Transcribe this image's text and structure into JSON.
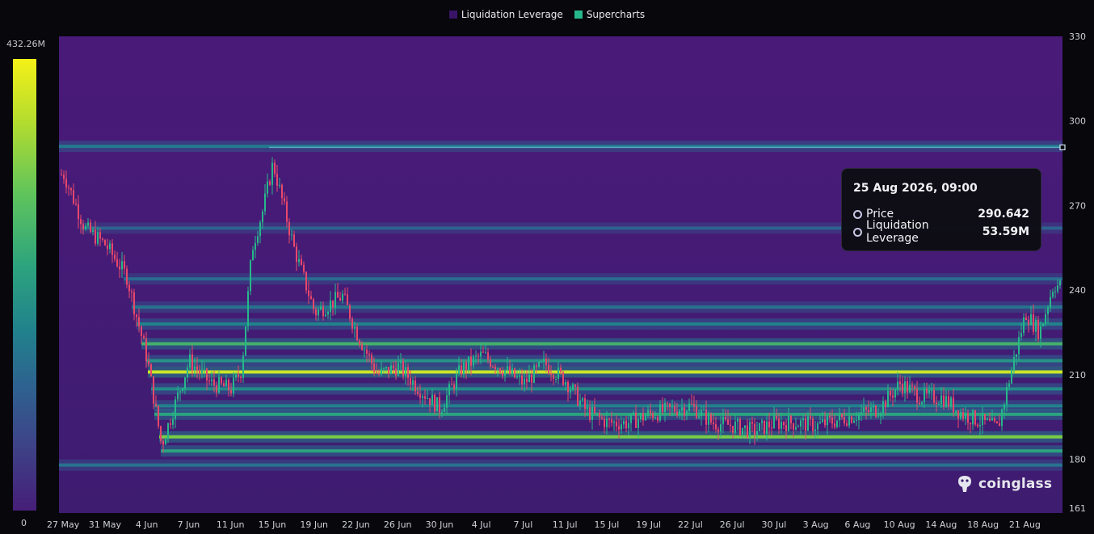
{
  "legend": [
    {
      "label": "Liquidation Leverage",
      "color": "#3a1466"
    },
    {
      "label": "Supercharts",
      "color": "#26b88a"
    }
  ],
  "color_scale": {
    "max_label": "432.26M",
    "min_label": "0"
  },
  "tooltip": {
    "title": "25 Aug 2026, 09:00",
    "rows": [
      {
        "label": "Price",
        "value": "290.642"
      },
      {
        "label": "Liquidation Leverage",
        "value": "53.59M"
      }
    ]
  },
  "brand": {
    "name": "coinglass"
  },
  "chart_data": {
    "type": "heatmap",
    "title": "",
    "xlabel": "",
    "ylabel": "",
    "x_tick_labels": [
      "27 May",
      "31 May",
      "4 Jun",
      "7 Jun",
      "11 Jun",
      "15 Jun",
      "19 Jun",
      "22 Jun",
      "26 Jun",
      "30 Jun",
      "4 Jul",
      "7 Jul",
      "11 Jul",
      "15 Jul",
      "19 Jul",
      "22 Jul",
      "26 Jul",
      "30 Jul",
      "3 Aug",
      "6 Aug",
      "10 Aug",
      "14 Aug",
      "18 Aug",
      "21 Aug"
    ],
    "y_ticks": [
      161,
      180,
      210,
      240,
      270,
      300,
      330
    ],
    "ylim": [
      161,
      330
    ],
    "legend_position": "top",
    "colors": {
      "up": "#26b88a",
      "down": "#e8486a",
      "heat_low": "#461e78",
      "heat_high": "#f5f117"
    },
    "current_price": 290.642,
    "price_path": [
      {
        "x": "27 May",
        "y": 281
      },
      {
        "x": "29 May",
        "y": 262
      },
      {
        "x": "31 May",
        "y": 256
      },
      {
        "x": "2 Jun",
        "y": 245
      },
      {
        "x": "4 Jun",
        "y": 215
      },
      {
        "x": "5 Jun",
        "y": 185
      },
      {
        "x": "7 Jun",
        "y": 215
      },
      {
        "x": "9 Jun",
        "y": 207
      },
      {
        "x": "11 Jun",
        "y": 205
      },
      {
        "x": "12 Jun",
        "y": 212
      },
      {
        "x": "13 Jun",
        "y": 255
      },
      {
        "x": "14 Jun",
        "y": 268
      },
      {
        "x": "15 Jun",
        "y": 285
      },
      {
        "x": "17 Jun",
        "y": 255
      },
      {
        "x": "19 Jun",
        "y": 232
      },
      {
        "x": "21 Jun",
        "y": 238
      },
      {
        "x": "22 Jun",
        "y": 225
      },
      {
        "x": "24 Jun",
        "y": 210
      },
      {
        "x": "26 Jun",
        "y": 213
      },
      {
        "x": "28 Jun",
        "y": 205
      },
      {
        "x": "30 Jun",
        "y": 198
      },
      {
        "x": "2 Jul",
        "y": 212
      },
      {
        "x": "4 Jul",
        "y": 217
      },
      {
        "x": "7 Jul",
        "y": 207
      },
      {
        "x": "9 Jul",
        "y": 214
      },
      {
        "x": "11 Jul",
        "y": 208
      },
      {
        "x": "13 Jul",
        "y": 197
      },
      {
        "x": "15 Jul",
        "y": 193
      },
      {
        "x": "17 Jul",
        "y": 193
      },
      {
        "x": "19 Jul",
        "y": 196
      },
      {
        "x": "22 Jul",
        "y": 199
      },
      {
        "x": "24 Jul",
        "y": 193
      },
      {
        "x": "26 Jul",
        "y": 192
      },
      {
        "x": "28 Jul",
        "y": 190
      },
      {
        "x": "30 Jul",
        "y": 193
      },
      {
        "x": "1 Aug",
        "y": 193
      },
      {
        "x": "3 Aug",
        "y": 192
      },
      {
        "x": "6 Aug",
        "y": 196
      },
      {
        "x": "8 Aug",
        "y": 198
      },
      {
        "x": "10 Aug",
        "y": 207
      },
      {
        "x": "12 Aug",
        "y": 202
      },
      {
        "x": "14 Aug",
        "y": 202
      },
      {
        "x": "16 Aug",
        "y": 196
      },
      {
        "x": "18 Aug",
        "y": 193
      },
      {
        "x": "19 Aug",
        "y": 191
      },
      {
        "x": "20 Aug",
        "y": 212
      },
      {
        "x": "21 Aug",
        "y": 232
      },
      {
        "x": "22 Aug",
        "y": 225
      },
      {
        "x": "23 Aug",
        "y": 242
      },
      {
        "x": "25 Aug",
        "y": 240
      }
    ],
    "liquidation_bands": [
      {
        "y": 291,
        "intensity": 0.45
      },
      {
        "y": 262,
        "intensity": 0.3
      },
      {
        "y": 244,
        "intensity": 0.35
      },
      {
        "y": 234,
        "intensity": 0.4
      },
      {
        "y": 228,
        "intensity": 0.5
      },
      {
        "y": 221,
        "intensity": 0.75
      },
      {
        "y": 215,
        "intensity": 0.6
      },
      {
        "y": 211,
        "intensity": 0.95
      },
      {
        "y": 205,
        "intensity": 0.55
      },
      {
        "y": 199,
        "intensity": 0.5
      },
      {
        "y": 196,
        "intensity": 0.7
      },
      {
        "y": 188,
        "intensity": 0.85
      },
      {
        "y": 183,
        "intensity": 0.7
      },
      {
        "y": 178,
        "intensity": 0.4
      }
    ]
  }
}
